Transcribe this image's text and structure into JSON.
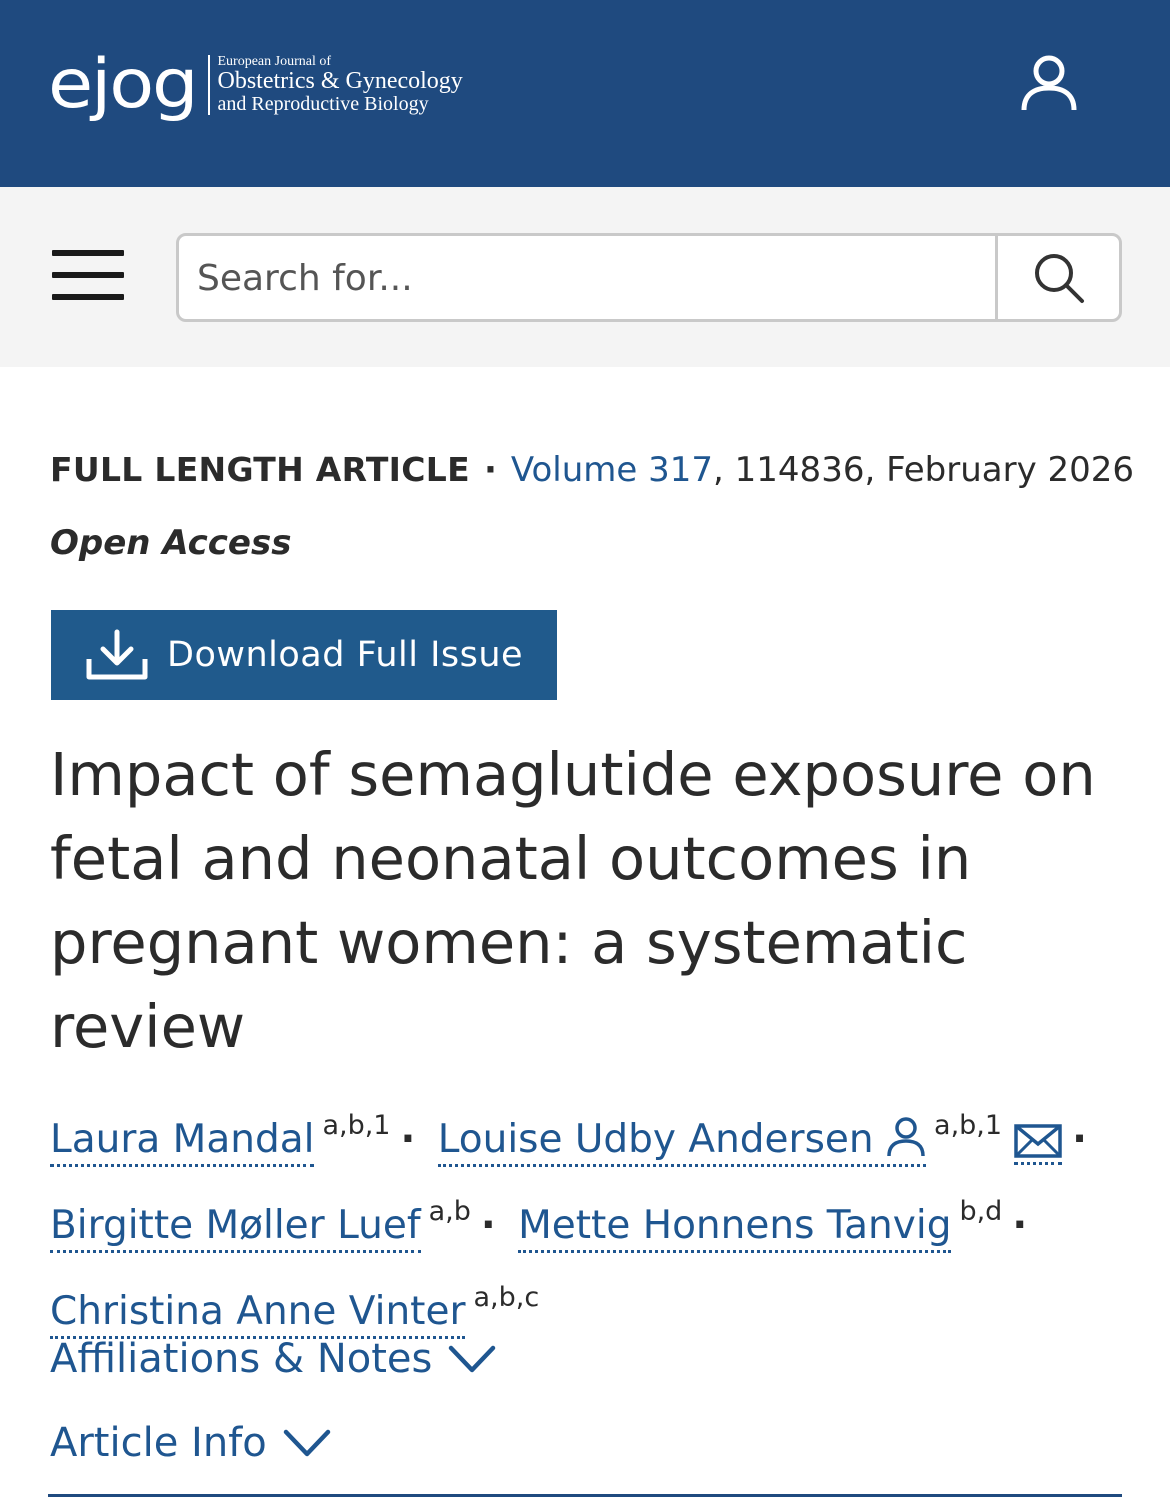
{
  "header": {
    "logo_mark": "ejog",
    "logo_line1": "European Journal of",
    "logo_line2": "Obstetrics & Gynecology",
    "logo_line3": "and Reproductive Biology",
    "bg_color": "#1f4a7f"
  },
  "search": {
    "placeholder": "Search for..."
  },
  "meta": {
    "article_type": "FULL LENGTH ARTICLE",
    "separator": "·",
    "volume_link": "Volume 317",
    "rest": ", 114836, February 2026",
    "access": "Open Access"
  },
  "download": {
    "label": "Download Full Issue"
  },
  "article": {
    "title": "Impact of semaglutide exposure on fetal and neonatal outcomes in pregnant women: a systematic review"
  },
  "authors": [
    {
      "name": "Laura Mandal",
      "sup": "a,b,1"
    },
    {
      "name": "Louise Udby Andersen",
      "sup": "a,b,1"
    },
    {
      "name": "Birgitte Møller Luef",
      "sup": "a,b"
    },
    {
      "name": "Mette Honnens Tanvig",
      "sup": "b,d"
    },
    {
      "name": "Christina Anne Vinter",
      "sup": "a,b,c"
    }
  ],
  "author_sep": "·",
  "sections": {
    "affiliations": "Affiliations & Notes",
    "article_info": "Article Info"
  },
  "colors": {
    "link": "#1f5690",
    "button": "#205a8c",
    "text": "#2b2b2b"
  },
  "icons": [
    "user-icon",
    "menu-icon",
    "search-icon",
    "download-icon",
    "person-icon",
    "mail-icon",
    "chevron-down-icon"
  ]
}
